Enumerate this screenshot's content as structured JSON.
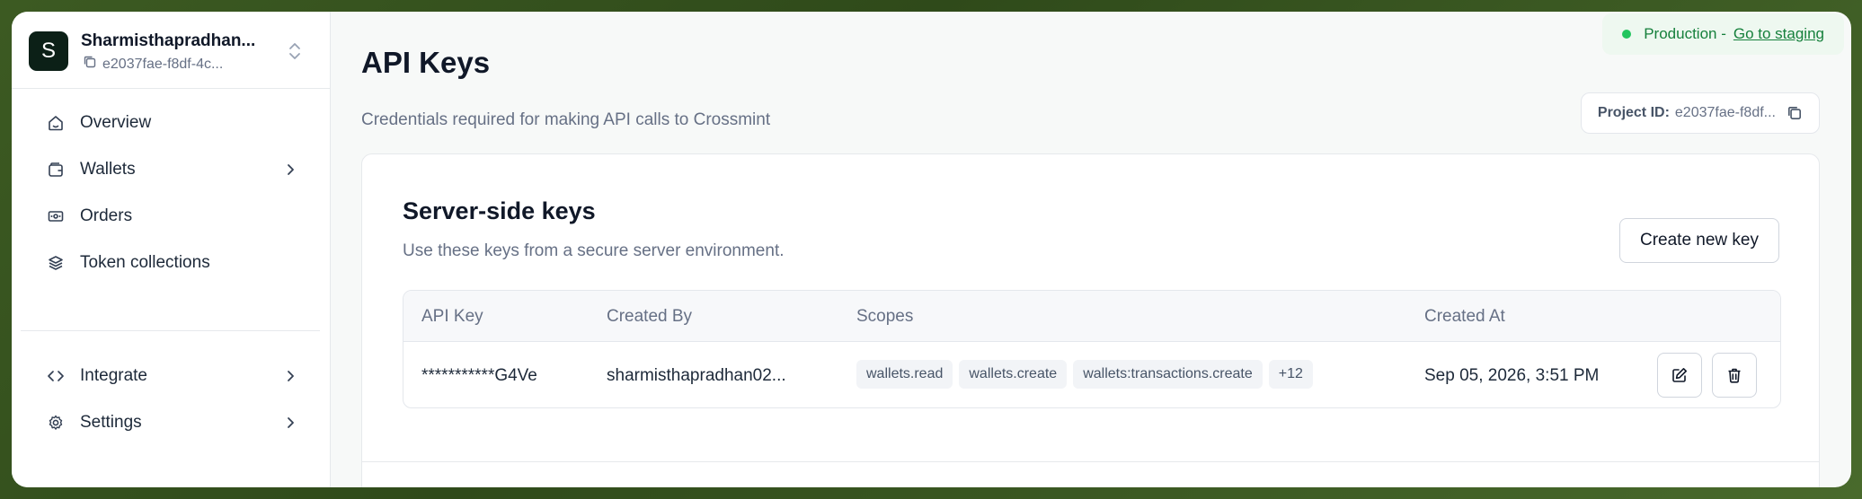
{
  "project": {
    "avatar_letter": "S",
    "name": "Sharmisthapradhan...",
    "id_short": "e2037fae-f8df-4c..."
  },
  "sidebar": {
    "items": [
      {
        "label": "Overview",
        "icon": "home-icon"
      },
      {
        "label": "Wallets",
        "icon": "wallet-icon"
      },
      {
        "label": "Orders",
        "icon": "orders-icon"
      },
      {
        "label": "Token collections",
        "icon": "layers-icon"
      },
      {
        "label": "Integrate",
        "icon": "code-icon"
      },
      {
        "label": "Settings",
        "icon": "gear-icon"
      }
    ]
  },
  "env": {
    "label": "Production - ",
    "link": "Go to staging"
  },
  "header": {
    "title": "API Keys",
    "subtitle": "Credentials required for making API calls to Crossmint",
    "project_id_label": "Project ID:",
    "project_id_value": "e2037fae-f8df..."
  },
  "server_keys": {
    "title": "Server-side keys",
    "subtitle": "Use these keys from a secure server environment.",
    "create_button": "Create new key",
    "columns": [
      "API Key",
      "Created By",
      "Scopes",
      "Created At"
    ],
    "rows": [
      {
        "api_key": "***********G4Ve",
        "created_by": "sharmisthapradhan02...",
        "scopes": [
          "wallets.read",
          "wallets.create",
          "wallets:transactions.create",
          "+12"
        ],
        "created_at": "Sep 05, 2026, 3:51 PM"
      }
    ]
  },
  "colors": {
    "accent_dark": "#0c2017",
    "production_green": "#16803c",
    "status_dot": "#22c55e"
  }
}
